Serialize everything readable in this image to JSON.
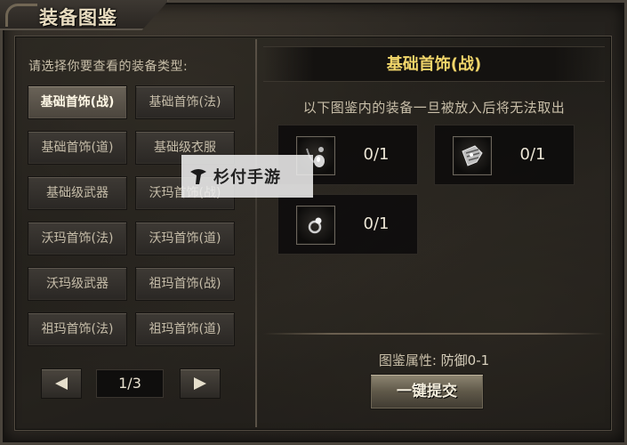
{
  "window": {
    "title": "装备图鉴"
  },
  "left_panel": {
    "prompt": "请选择你要查看的装备类型:",
    "categories": [
      {
        "label": "基础首饰(战)",
        "active": true
      },
      {
        "label": "基础首饰(法)",
        "active": false
      },
      {
        "label": "基础首饰(道)",
        "active": false
      },
      {
        "label": "基础级衣服",
        "active": false
      },
      {
        "label": "基础级武器",
        "active": false
      },
      {
        "label": "沃玛首饰(战)",
        "active": false
      },
      {
        "label": "沃玛首饰(法)",
        "active": false
      },
      {
        "label": "沃玛首饰(道)",
        "active": false
      },
      {
        "label": "沃玛级武器",
        "active": false
      },
      {
        "label": "祖玛首饰(战)",
        "active": false
      },
      {
        "label": "祖玛首饰(法)",
        "active": false
      },
      {
        "label": "祖玛首饰(道)",
        "active": false
      }
    ],
    "pager": {
      "page": "1/3",
      "prev_icon": "triangle-left-icon",
      "next_icon": "triangle-right-icon"
    }
  },
  "right_panel": {
    "set_title": "基础首饰(战)",
    "notice": "以下图鉴内的装备一旦被放入后将无法取出",
    "slots": [
      {
        "item_icon": "necklace-icon",
        "count": "0/1"
      },
      {
        "item_icon": "bracelet-icon",
        "count": "0/1"
      },
      {
        "item_icon": "ring-icon",
        "count": "0/1"
      }
    ],
    "attribute": {
      "label": "图鉴属性:",
      "value": "防御0-1"
    },
    "submit_label": "一键提交"
  },
  "watermark": {
    "text": "杉付手游"
  },
  "colors": {
    "title_gold": "#f1d56a",
    "text": "#c9bfa9",
    "panel_bg": "#24211d"
  }
}
